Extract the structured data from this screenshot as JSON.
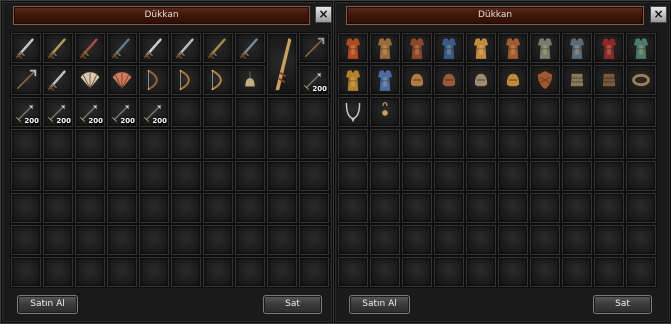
{
  "windows": [
    {
      "title": "Dükkan",
      "close_icon": "×",
      "buy_label": "Satın Al",
      "sell_label": "Sat",
      "items": [
        {
          "icon": "sword-icon",
          "color": "#c8c8c8"
        },
        {
          "icon": "scimitar-icon",
          "color": "#b89a5a"
        },
        {
          "icon": "dagger-icon",
          "color": "#a0523a"
        },
        {
          "icon": "knife-icon",
          "color": "#5e7a8a"
        },
        {
          "icon": "curved-sword-icon",
          "color": "#cfcfcf"
        },
        {
          "icon": "hook-blade-icon",
          "color": "#bcbcbc"
        },
        {
          "icon": "crescent-blade-icon",
          "color": "#a68a4a"
        },
        {
          "icon": "broad-sword-icon",
          "color": "#7a8a9a"
        },
        {
          "icon": "great-spear-icon",
          "color": "#c9a060",
          "tall": true
        },
        {
          "icon": "spear-icon",
          "color": "#9a9a9a"
        },
        {
          "icon": "trident-icon",
          "color": "#bbbbbb"
        },
        {
          "icon": "saber-icon",
          "color": "#c0c0c0"
        },
        {
          "icon": "folding-fan-icon",
          "color": "#d8c8b0"
        },
        {
          "icon": "war-fan-icon",
          "color": "#d07a5a"
        },
        {
          "icon": "short-bow-icon",
          "color": "#9a6a3a"
        },
        {
          "icon": "long-bow-icon",
          "color": "#b07a40"
        },
        {
          "icon": "composite-bow-icon",
          "color": "#c08a50"
        },
        {
          "icon": "bell-icon",
          "color": "#c0b080"
        },
        {
          "icon": "arrow-icon",
          "color": "#c8c8c8",
          "qty": "200"
        },
        {
          "icon": "arrow-icon",
          "color": "#c8c8c8",
          "qty": "200"
        },
        {
          "icon": "arrow-icon",
          "color": "#c8c8c8",
          "qty": "200"
        },
        {
          "icon": "arrow-icon",
          "color": "#c8c8c8",
          "qty": "200"
        },
        {
          "icon": "arrow-icon",
          "color": "#c8c8c8",
          "qty": "200"
        },
        {
          "icon": "arrow-icon",
          "color": "#c8c8c8",
          "qty": "200"
        }
      ]
    },
    {
      "title": "Dükkan",
      "close_icon": "×",
      "buy_label": "Satın Al",
      "sell_label": "Sat",
      "items": [
        {
          "icon": "dragon-armor-icon",
          "color": "#b04a20"
        },
        {
          "icon": "plate-armor-icon",
          "color": "#9a6a3a"
        },
        {
          "icon": "scale-armor-icon",
          "color": "#8a4a2a"
        },
        {
          "icon": "robe-armor-icon",
          "color": "#3a5a8a"
        },
        {
          "icon": "light-armor-icon",
          "color": "#c08a40"
        },
        {
          "icon": "leather-armor-icon",
          "color": "#a05a30"
        },
        {
          "icon": "chain-armor-icon",
          "color": "#7a7a6a"
        },
        {
          "icon": "steel-armor-icon",
          "color": "#5a6a7a"
        },
        {
          "icon": "crimson-armor-icon",
          "color": "#8a2a2a"
        },
        {
          "icon": "jade-armor-icon",
          "color": "#4a7a6a"
        },
        {
          "icon": "gold-robe-icon",
          "color": "#b08030"
        },
        {
          "icon": "silk-robe-icon",
          "color": "#4a6aa0"
        },
        {
          "icon": "helmet-icon",
          "color": "#b07a40"
        },
        {
          "icon": "hood-icon",
          "color": "#9a5a3a"
        },
        {
          "icon": "winged-helmet-icon",
          "color": "#a08a70"
        },
        {
          "icon": "crown-icon",
          "color": "#c08a3a"
        },
        {
          "icon": "shield-icon",
          "color": "#a05a30"
        },
        {
          "icon": "bracer-icon",
          "color": "#8a7a5a"
        },
        {
          "icon": "boots-icon",
          "color": "#7a5a3a"
        },
        {
          "icon": "bracelet-icon",
          "color": "#a08050"
        },
        {
          "icon": "necklace-icon",
          "color": "#c8c8c8"
        },
        {
          "icon": "earring-icon",
          "color": "#d0a060"
        }
      ]
    }
  ]
}
